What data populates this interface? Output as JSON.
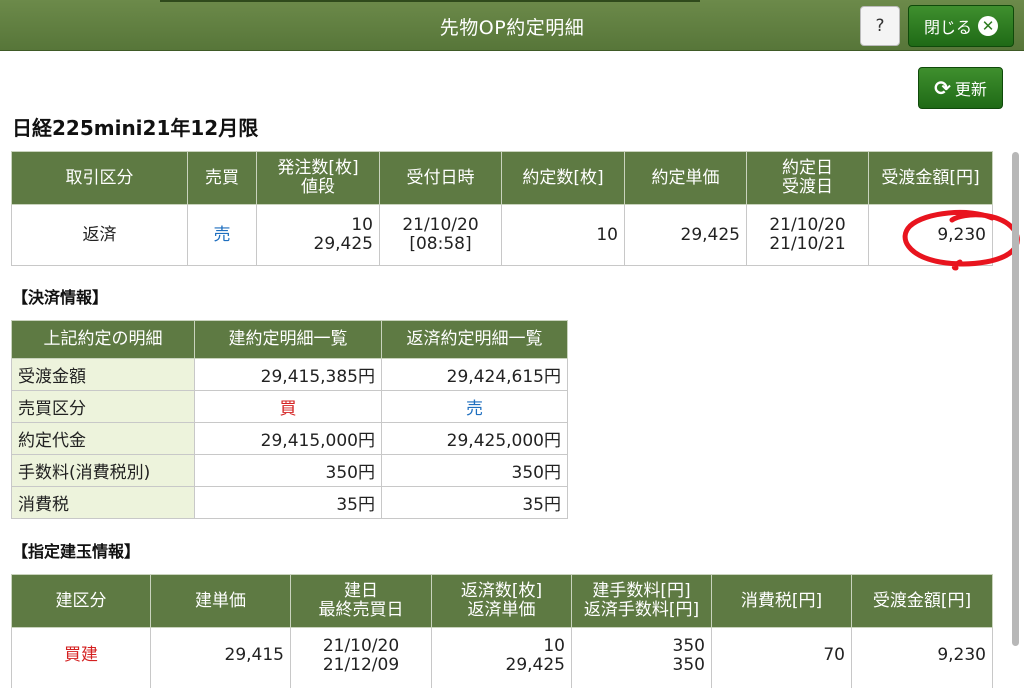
{
  "window": {
    "title": "先物OP約定明細",
    "help_label": "?",
    "close_label": "閉じる",
    "refresh_label": "更新"
  },
  "product_title": "日経225mini21年12月限",
  "order": {
    "headers": [
      "取引区分",
      "売買",
      "発注数[枚]",
      "値段",
      "受付日時",
      "約定数[枚]",
      "約定単価",
      "約定日",
      "受渡日",
      "受渡金額[円]"
    ],
    "row": {
      "trade_type": "返済",
      "side": "売",
      "order_qty": "10",
      "order_price": "29,425",
      "accept_date": "21/10/20",
      "accept_time": "[08:58]",
      "exec_qty": "10",
      "exec_price": "29,425",
      "exec_date": "21/10/20",
      "settle_date": "21/10/21",
      "settle_amount": "9,230"
    }
  },
  "settlement": {
    "section_title": "【決済情報】",
    "headers": [
      "上記約定の明細",
      "建約定明細一覧",
      "返済約定明細一覧"
    ],
    "rows": [
      {
        "label": "受渡金額",
        "open": "29,415,385円",
        "close": "29,424,615円"
      },
      {
        "label": "売買区分",
        "open": "買",
        "close": "売"
      },
      {
        "label": "約定代金",
        "open": "29,415,000円",
        "close": "29,425,000円"
      },
      {
        "label": "手数料(消費税別)",
        "open": "350円",
        "close": "350円"
      },
      {
        "label": "消費税",
        "open": "35円",
        "close": "35円"
      }
    ]
  },
  "positions": {
    "section_title": "【指定建玉情報】",
    "headers": [
      "建区分",
      "建単価",
      "建日",
      "最終売買日",
      "返済数[枚]",
      "返済単価",
      "建手数料[円]",
      "返済手数料[円]",
      "消費税[円]",
      "受渡金額[円]"
    ],
    "row": {
      "type": "買建",
      "price": "29,415",
      "open_date": "21/10/20",
      "last_trade_date": "21/12/09",
      "close_qty": "10",
      "close_price": "29,425",
      "open_fee": "350",
      "close_fee": "350",
      "tax": "70",
      "settle_amount": "9,230"
    }
  },
  "colors": {
    "header_green": "#5e7a43",
    "label_bg": "#edf3dc",
    "sell_blue": "#1f6fbf",
    "buy_red": "#d42020",
    "annotation_red": "#e8141e"
  }
}
